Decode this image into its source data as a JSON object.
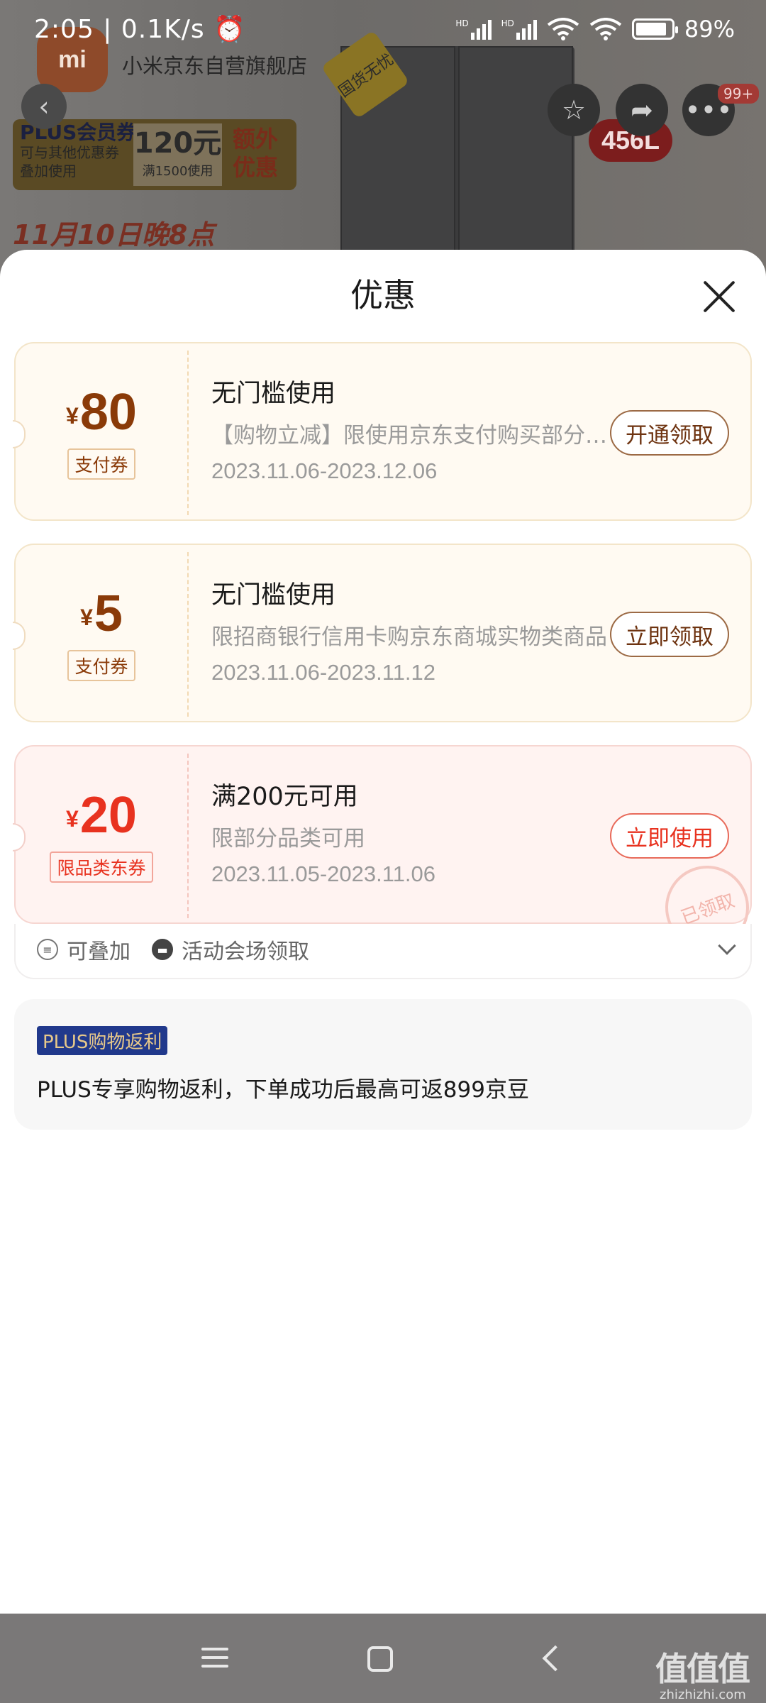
{
  "status_bar": {
    "time": "2:05",
    "speed": "| 0.1K/s",
    "battery": "89%",
    "network_labels": [
      "HD",
      "HD"
    ]
  },
  "background_page": {
    "store_name": "小米京东自营旗舰店",
    "logo_text": "mi",
    "crown_text": "国货无忧",
    "capacity_badge": "456L",
    "plus_banner": {
      "title": "PLUS会员券",
      "subtitle_line1": "可与其他优惠券",
      "subtitle_line2": "叠加使用",
      "amount": "120元",
      "condition": "满1500使用",
      "highlight": "额外优惠"
    },
    "date_strip": "11月10日晚8点",
    "notification_count": "99+"
  },
  "sheet": {
    "title": "优惠",
    "coupons": [
      {
        "currency": "¥",
        "amount": "80",
        "type_tag": "支付券",
        "title": "无门槛使用",
        "description": "【购物立减】限使用京东支付购买部分商品",
        "validity": "2023.11.06-2023.12.06",
        "action": "开通领取",
        "style": "gold"
      },
      {
        "currency": "¥",
        "amount": "5",
        "type_tag": "支付券",
        "title": "无门槛使用",
        "description": "限招商银行信用卡购京东商城实物类商品",
        "validity": "2023.11.06-2023.11.12",
        "action": "立即领取",
        "style": "gold"
      },
      {
        "currency": "¥",
        "amount": "20",
        "type_tag": "限品类东券",
        "title": "满200元可用",
        "description": "限部分品类可用",
        "validity": "2023.11.05-2023.11.06",
        "action": "立即使用",
        "stamp": "已领取",
        "style": "red"
      }
    ],
    "coupon_meta": {
      "stackable": "可叠加",
      "source": "活动会场领取"
    },
    "plus_rebate": {
      "badge": "PLUS购物返利",
      "text": "PLUS专享购物返利，下单成功后最高可返899京豆"
    }
  },
  "watermark": {
    "logo": "值值值",
    "domain": "zhizhizhi.com"
  },
  "colors": {
    "accent_gold": "#8a3a08",
    "accent_red": "#e8321f",
    "plus_blue": "#21398c"
  }
}
